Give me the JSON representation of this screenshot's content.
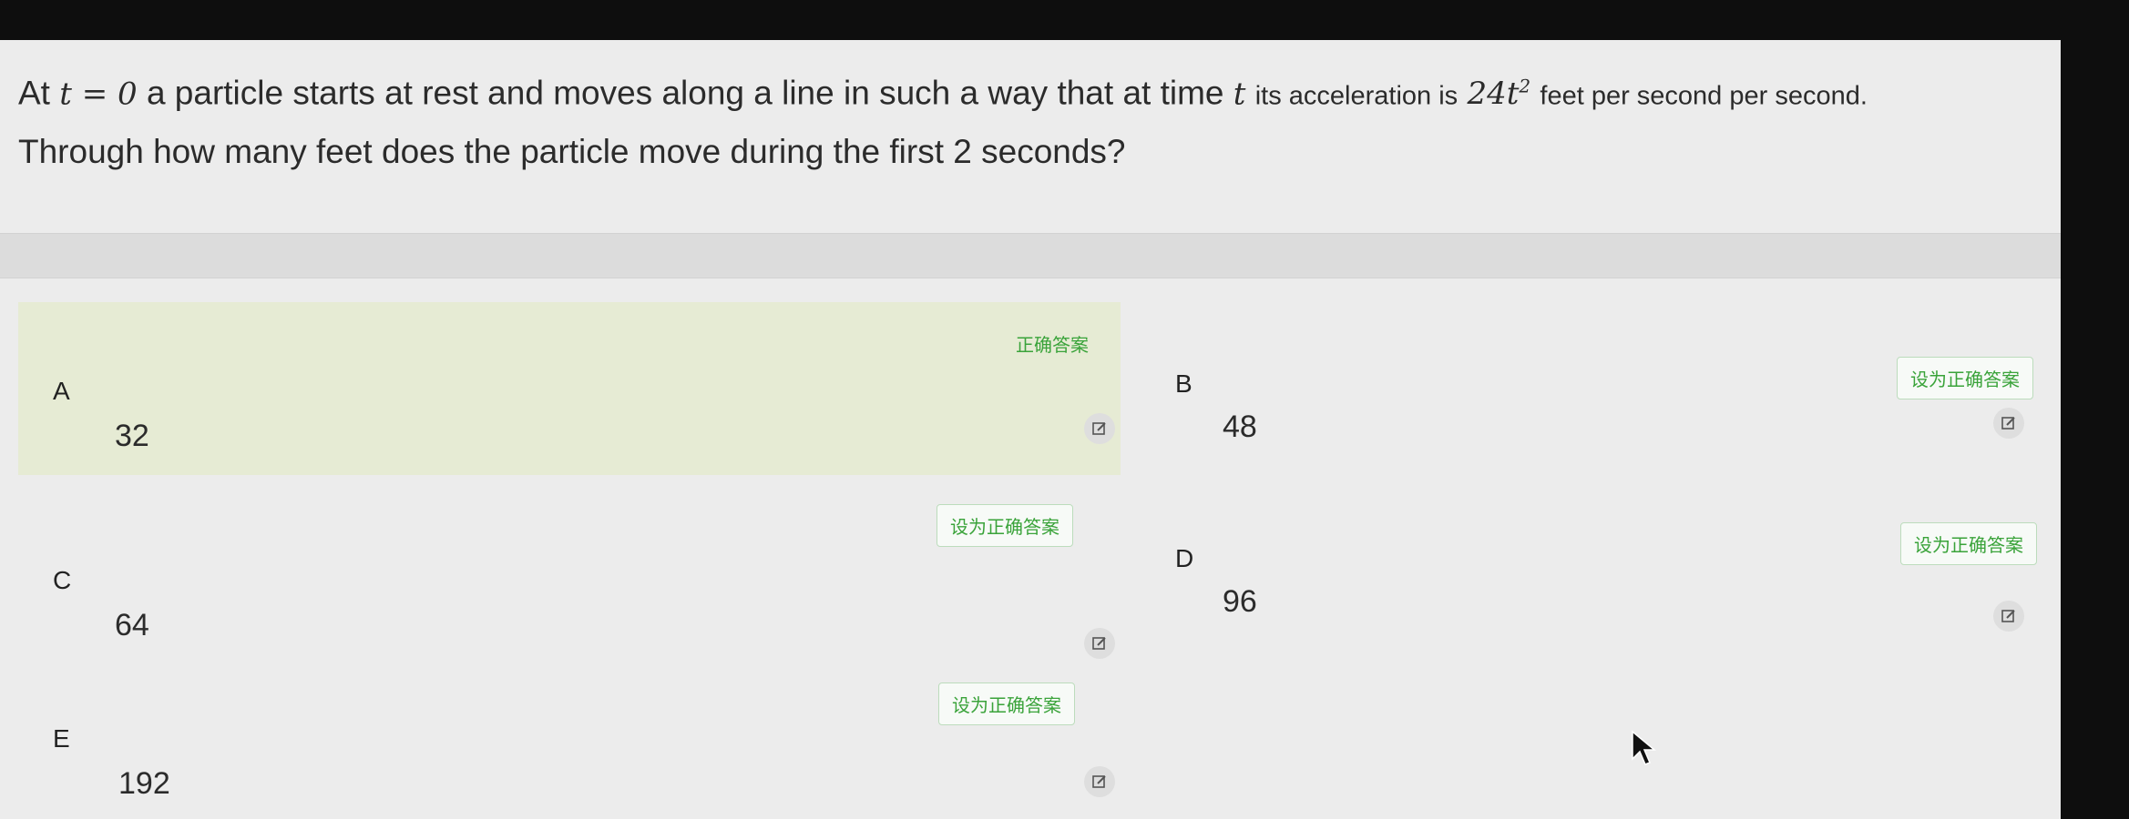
{
  "question": {
    "at": "At",
    "t_equals_zero": "t = 0",
    "part1": "a particle starts at rest and moves along a line in such a way that at time",
    "t_var": "t",
    "part2": "its acceleration is",
    "accel_base": "24t",
    "accel_exp": "2",
    "part3": "feet per second per second.",
    "line2": "Through how many feet does the particle move during the first 2 seconds?"
  },
  "options": [
    {
      "letter": "A",
      "value": "32",
      "button": "正确答案",
      "is_correct": true
    },
    {
      "letter": "B",
      "value": "48",
      "button": "设为正确答案",
      "is_correct": false
    },
    {
      "letter": "C",
      "value": "64",
      "button": "设为正确答案",
      "is_correct": false
    },
    {
      "letter": "D",
      "value": "96",
      "button": "设为正确答案",
      "is_correct": false
    },
    {
      "letter": "E",
      "value": "192",
      "button": "设为正确答案",
      "is_correct": false
    }
  ],
  "icons": {
    "edit": "edit-icon",
    "cursor": "mouse-cursor-icon"
  },
  "colors": {
    "correct_bg": "#e6ebd4",
    "button_text": "#3aa33a",
    "page_bg": "#ececec"
  }
}
